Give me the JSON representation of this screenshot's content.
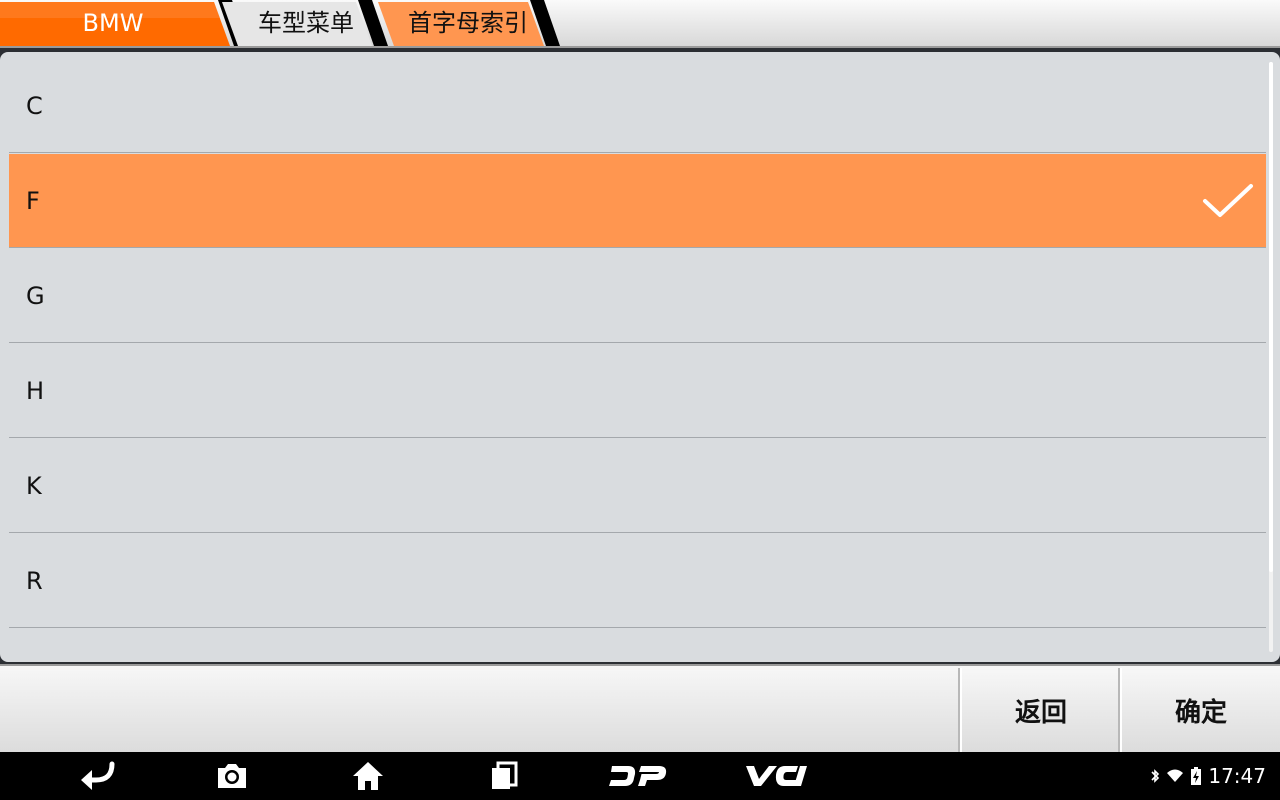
{
  "breadcrumb": {
    "items": [
      {
        "label": "BMW",
        "color": "#ff6a00"
      },
      {
        "label": "车型菜单",
        "color": "#e0e0e0"
      },
      {
        "label": "首字母索引",
        "color": "#ff9650"
      }
    ]
  },
  "list": {
    "items": [
      {
        "label": "C",
        "selected": false
      },
      {
        "label": "F",
        "selected": true
      },
      {
        "label": "G",
        "selected": false
      },
      {
        "label": "H",
        "selected": false
      },
      {
        "label": "K",
        "selected": false
      },
      {
        "label": "R",
        "selected": false
      }
    ],
    "selected_color": "#ff9650"
  },
  "actions": {
    "back_label": "返回",
    "confirm_label": "确定"
  },
  "navbar": {
    "buttons": [
      "back-arrow-icon",
      "camera-icon",
      "home-icon",
      "recent-apps-icon",
      "dp-logo-icon",
      "vci-logo-icon"
    ]
  },
  "status": {
    "icons": [
      "bluetooth-icon",
      "wifi-icon",
      "battery-charging-icon"
    ],
    "time": "17:47"
  }
}
